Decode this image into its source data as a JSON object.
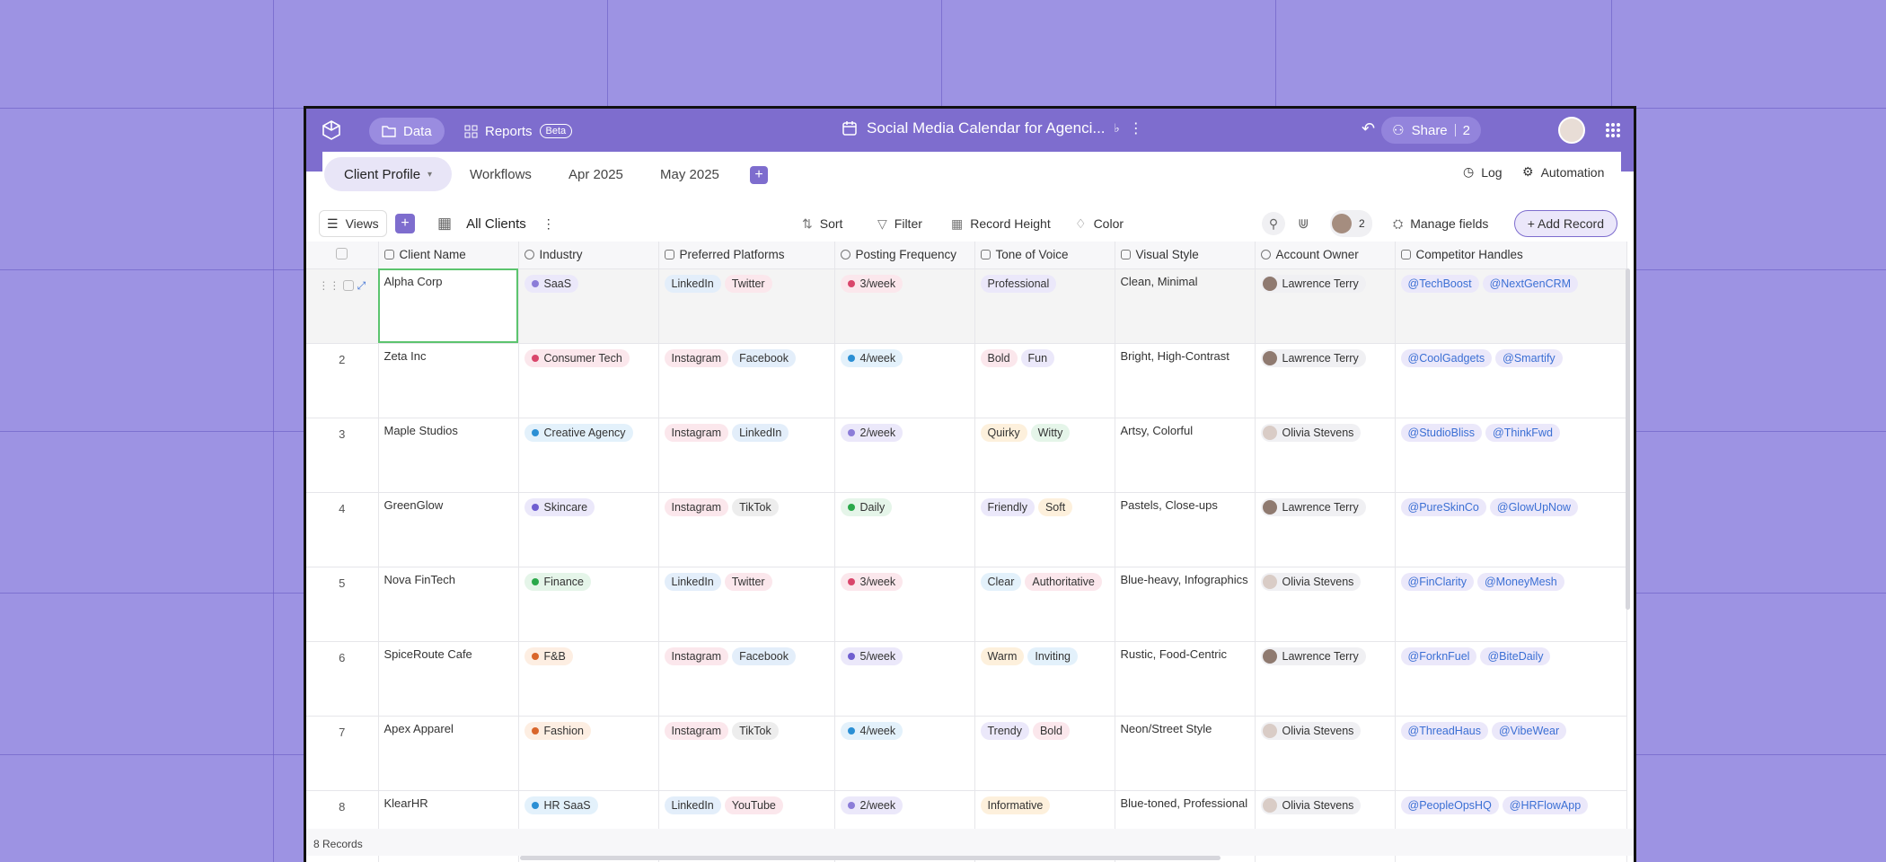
{
  "topbar": {
    "data_label": "Data",
    "reports_label": "Reports",
    "beta_badge": "Beta",
    "doc_title": "Social Media Calendar for Agenci...",
    "share_label": "Share",
    "share_count": "2"
  },
  "tabs": [
    {
      "label": "Client Profile"
    },
    {
      "label": "Workflows"
    },
    {
      "label": "Apr 2025"
    },
    {
      "label": "May 2025"
    }
  ],
  "tab_right": {
    "log": "Log",
    "automation": "Automation"
  },
  "toolbar": {
    "views": "Views",
    "view_name": "All Clients",
    "sort": "Sort",
    "filter": "Filter",
    "record_height": "Record Height",
    "color": "Color",
    "collab_count": "2",
    "manage_fields": "Manage fields",
    "add_record": "+ Add Record"
  },
  "columns": [
    "Client Name",
    "Industry",
    "Preferred Platforms",
    "Posting Frequency",
    "Tone of Voice",
    "Visual Style",
    "Account Owner",
    "Competitor Handles"
  ],
  "rows": [
    {
      "num": "",
      "name": "Alpha Corp",
      "industry": "SaaS",
      "ind_color": "#8b7cd8",
      "ind_bg": "#ebe8fa",
      "platforms": [
        "LinkedIn",
        "Twitter"
      ],
      "freq": "3/week",
      "freq_color": "#d9466b",
      "freq_bg": "#fbe7ec",
      "tone": [
        "Professional"
      ],
      "visual": "Clean, Minimal",
      "owner": "Lawrence Terry",
      "handles": [
        "@TechBoost",
        "@NextGenCRM"
      ]
    },
    {
      "num": "2",
      "name": "Zeta Inc",
      "industry": "Consumer Tech",
      "ind_color": "#d9466b",
      "ind_bg": "#fbe7ec",
      "platforms": [
        "Instagram",
        "Facebook"
      ],
      "freq": "4/week",
      "freq_color": "#2b8fd4",
      "freq_bg": "#e3f1fb",
      "tone": [
        "Bold",
        "Fun"
      ],
      "visual": "Bright, High-Contrast",
      "owner": "Lawrence Terry",
      "handles": [
        "@CoolGadgets",
        "@Smartify"
      ]
    },
    {
      "num": "3",
      "name": "Maple Studios",
      "industry": "Creative Agency",
      "ind_color": "#2b8fd4",
      "ind_bg": "#e3f1fb",
      "platforms": [
        "Instagram",
        "LinkedIn"
      ],
      "freq": "2/week",
      "freq_color": "#8b7cd8",
      "freq_bg": "#ebe8fa",
      "tone": [
        "Quirky",
        "Witty"
      ],
      "visual": "Artsy, Colorful",
      "owner": "Olivia Stevens",
      "handles": [
        "@StudioBliss",
        "@ThinkFwd"
      ]
    },
    {
      "num": "4",
      "name": "GreenGlow",
      "industry": "Skincare",
      "ind_color": "#6f5fd0",
      "ind_bg": "#ebe8fa",
      "platforms": [
        "Instagram",
        "TikTok"
      ],
      "freq": "Daily",
      "freq_color": "#2aa84a",
      "freq_bg": "#e5f5e9",
      "tone": [
        "Friendly",
        "Soft"
      ],
      "visual": "Pastels, Close-ups",
      "owner": "Lawrence Terry",
      "handles": [
        "@PureSkinCo",
        "@GlowUpNow"
      ]
    },
    {
      "num": "5",
      "name": "Nova FinTech",
      "industry": "Finance",
      "ind_color": "#2aa84a",
      "ind_bg": "#e5f5e9",
      "platforms": [
        "LinkedIn",
        "Twitter"
      ],
      "freq": "3/week",
      "freq_color": "#d9466b",
      "freq_bg": "#fbe7ec",
      "tone": [
        "Clear",
        "Authoritative"
      ],
      "visual": "Blue-heavy, Infographics",
      "owner": "Olivia Stevens",
      "handles": [
        "@FinClarity",
        "@MoneyMesh"
      ]
    },
    {
      "num": "6",
      "name": "SpiceRoute Cafe",
      "industry": "F&B",
      "ind_color": "#d9662b",
      "ind_bg": "#fdeee2",
      "platforms": [
        "Instagram",
        "Facebook"
      ],
      "freq": "5/week",
      "freq_color": "#6f5fd0",
      "freq_bg": "#ebe8fa",
      "tone": [
        "Warm",
        "Inviting"
      ],
      "visual": "Rustic, Food-Centric",
      "owner": "Lawrence Terry",
      "handles": [
        "@ForknFuel",
        "@BiteDaily"
      ]
    },
    {
      "num": "7",
      "name": "Apex Apparel",
      "industry": "Fashion",
      "ind_color": "#d9662b",
      "ind_bg": "#fdeee2",
      "platforms": [
        "Instagram",
        "TikTok"
      ],
      "freq": "4/week",
      "freq_color": "#2b8fd4",
      "freq_bg": "#e3f1fb",
      "tone": [
        "Trendy",
        "Bold"
      ],
      "visual": "Neon/Street Style",
      "owner": "Olivia Stevens",
      "handles": [
        "@ThreadHaus",
        "@VibeWear"
      ]
    },
    {
      "num": "8",
      "name": "KlearHR",
      "industry": "HR SaaS",
      "ind_color": "#2b8fd4",
      "ind_bg": "#e3f1fb",
      "platforms": [
        "LinkedIn",
        "YouTube"
      ],
      "freq": "2/week",
      "freq_color": "#8b7cd8",
      "freq_bg": "#ebe8fa",
      "tone": [
        "Informative"
      ],
      "visual": "Blue-toned, Professional",
      "owner": "Olivia Stevens",
      "handles": [
        "@PeopleOpsHQ",
        "@HRFlowApp"
      ]
    }
  ],
  "chip_colors": {
    "LinkedIn": "#e3eefa",
    "Twitter": "#fbe7ec",
    "Instagram": "#fbe7ec",
    "Facebook": "#e3eefa",
    "TikTok": "#ededed",
    "YouTube": "#fbe7ec",
    "Professional": "#ebe8fa",
    "Bold": "#fbe7ec",
    "Fun": "#ebe8fa",
    "Quirky": "#fdf0dc",
    "Witty": "#e5f5e9",
    "Friendly": "#ebe8fa",
    "Soft": "#fdf0dc",
    "Clear": "#e3f1fb",
    "Authoritative": "#fbe7ec",
    "Warm": "#fdf0dc",
    "Inviting": "#e3f1fb",
    "Trendy": "#ebe8fa",
    "Informative": "#fdf0dc"
  },
  "footer": {
    "records": "8 Records"
  }
}
